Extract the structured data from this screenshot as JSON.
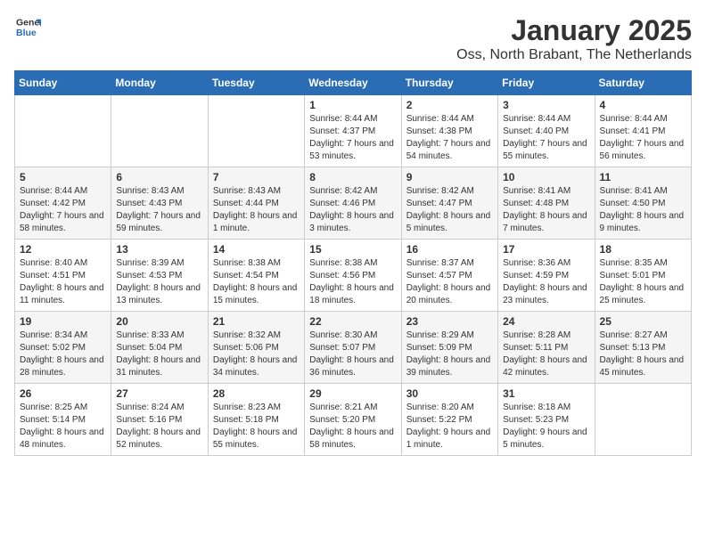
{
  "header": {
    "logo_line1": "General",
    "logo_line2": "Blue",
    "month": "January 2025",
    "location": "Oss, North Brabant, The Netherlands"
  },
  "weekdays": [
    "Sunday",
    "Monday",
    "Tuesday",
    "Wednesday",
    "Thursday",
    "Friday",
    "Saturday"
  ],
  "weeks": [
    [
      {
        "day": "",
        "info": ""
      },
      {
        "day": "",
        "info": ""
      },
      {
        "day": "",
        "info": ""
      },
      {
        "day": "1",
        "info": "Sunrise: 8:44 AM\nSunset: 4:37 PM\nDaylight: 7 hours and 53 minutes."
      },
      {
        "day": "2",
        "info": "Sunrise: 8:44 AM\nSunset: 4:38 PM\nDaylight: 7 hours and 54 minutes."
      },
      {
        "day": "3",
        "info": "Sunrise: 8:44 AM\nSunset: 4:40 PM\nDaylight: 7 hours and 55 minutes."
      },
      {
        "day": "4",
        "info": "Sunrise: 8:44 AM\nSunset: 4:41 PM\nDaylight: 7 hours and 56 minutes."
      }
    ],
    [
      {
        "day": "5",
        "info": "Sunrise: 8:44 AM\nSunset: 4:42 PM\nDaylight: 7 hours and 58 minutes."
      },
      {
        "day": "6",
        "info": "Sunrise: 8:43 AM\nSunset: 4:43 PM\nDaylight: 7 hours and 59 minutes."
      },
      {
        "day": "7",
        "info": "Sunrise: 8:43 AM\nSunset: 4:44 PM\nDaylight: 8 hours and 1 minute."
      },
      {
        "day": "8",
        "info": "Sunrise: 8:42 AM\nSunset: 4:46 PM\nDaylight: 8 hours and 3 minutes."
      },
      {
        "day": "9",
        "info": "Sunrise: 8:42 AM\nSunset: 4:47 PM\nDaylight: 8 hours and 5 minutes."
      },
      {
        "day": "10",
        "info": "Sunrise: 8:41 AM\nSunset: 4:48 PM\nDaylight: 8 hours and 7 minutes."
      },
      {
        "day": "11",
        "info": "Sunrise: 8:41 AM\nSunset: 4:50 PM\nDaylight: 8 hours and 9 minutes."
      }
    ],
    [
      {
        "day": "12",
        "info": "Sunrise: 8:40 AM\nSunset: 4:51 PM\nDaylight: 8 hours and 11 minutes."
      },
      {
        "day": "13",
        "info": "Sunrise: 8:39 AM\nSunset: 4:53 PM\nDaylight: 8 hours and 13 minutes."
      },
      {
        "day": "14",
        "info": "Sunrise: 8:38 AM\nSunset: 4:54 PM\nDaylight: 8 hours and 15 minutes."
      },
      {
        "day": "15",
        "info": "Sunrise: 8:38 AM\nSunset: 4:56 PM\nDaylight: 8 hours and 18 minutes."
      },
      {
        "day": "16",
        "info": "Sunrise: 8:37 AM\nSunset: 4:57 PM\nDaylight: 8 hours and 20 minutes."
      },
      {
        "day": "17",
        "info": "Sunrise: 8:36 AM\nSunset: 4:59 PM\nDaylight: 8 hours and 23 minutes."
      },
      {
        "day": "18",
        "info": "Sunrise: 8:35 AM\nSunset: 5:01 PM\nDaylight: 8 hours and 25 minutes."
      }
    ],
    [
      {
        "day": "19",
        "info": "Sunrise: 8:34 AM\nSunset: 5:02 PM\nDaylight: 8 hours and 28 minutes."
      },
      {
        "day": "20",
        "info": "Sunrise: 8:33 AM\nSunset: 5:04 PM\nDaylight: 8 hours and 31 minutes."
      },
      {
        "day": "21",
        "info": "Sunrise: 8:32 AM\nSunset: 5:06 PM\nDaylight: 8 hours and 34 minutes."
      },
      {
        "day": "22",
        "info": "Sunrise: 8:30 AM\nSunset: 5:07 PM\nDaylight: 8 hours and 36 minutes."
      },
      {
        "day": "23",
        "info": "Sunrise: 8:29 AM\nSunset: 5:09 PM\nDaylight: 8 hours and 39 minutes."
      },
      {
        "day": "24",
        "info": "Sunrise: 8:28 AM\nSunset: 5:11 PM\nDaylight: 8 hours and 42 minutes."
      },
      {
        "day": "25",
        "info": "Sunrise: 8:27 AM\nSunset: 5:13 PM\nDaylight: 8 hours and 45 minutes."
      }
    ],
    [
      {
        "day": "26",
        "info": "Sunrise: 8:25 AM\nSunset: 5:14 PM\nDaylight: 8 hours and 48 minutes."
      },
      {
        "day": "27",
        "info": "Sunrise: 8:24 AM\nSunset: 5:16 PM\nDaylight: 8 hours and 52 minutes."
      },
      {
        "day": "28",
        "info": "Sunrise: 8:23 AM\nSunset: 5:18 PM\nDaylight: 8 hours and 55 minutes."
      },
      {
        "day": "29",
        "info": "Sunrise: 8:21 AM\nSunset: 5:20 PM\nDaylight: 8 hours and 58 minutes."
      },
      {
        "day": "30",
        "info": "Sunrise: 8:20 AM\nSunset: 5:22 PM\nDaylight: 9 hours and 1 minute."
      },
      {
        "day": "31",
        "info": "Sunrise: 8:18 AM\nSunset: 5:23 PM\nDaylight: 9 hours and 5 minutes."
      },
      {
        "day": "",
        "info": ""
      }
    ]
  ]
}
